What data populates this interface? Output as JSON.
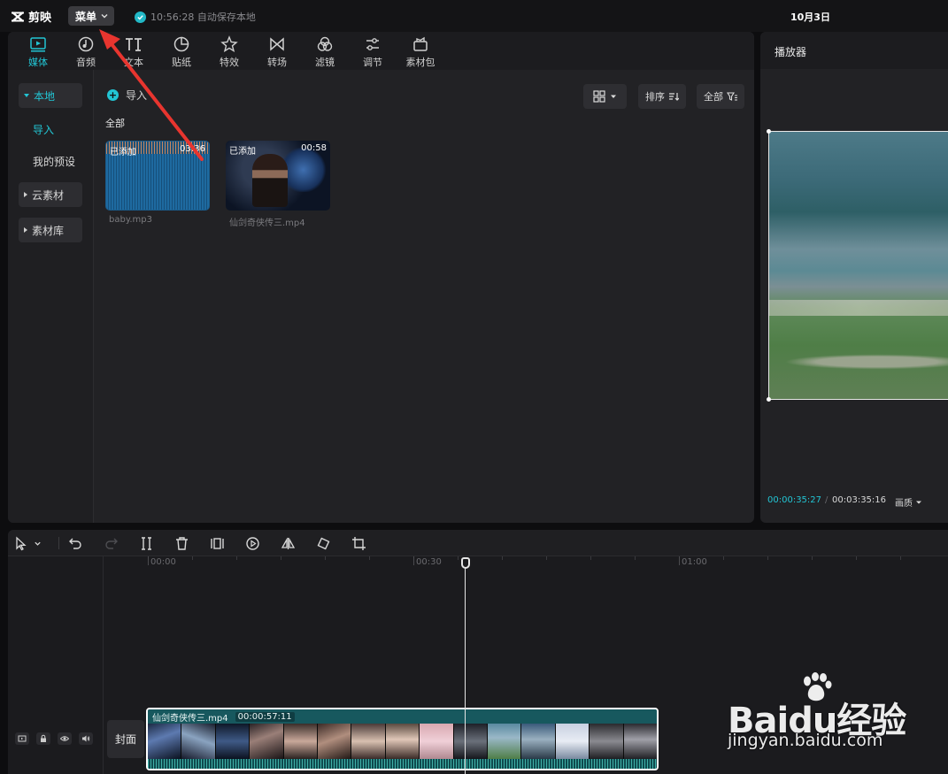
{
  "app": {
    "name": "剪映",
    "menu_label": "菜单"
  },
  "autosave": {
    "text": "10:56:28 自动保存本地"
  },
  "date": "10月3日",
  "tool_tabs": [
    {
      "label": "媒体",
      "icon": "media-icon",
      "active": true
    },
    {
      "label": "音频",
      "icon": "audio-icon"
    },
    {
      "label": "文本",
      "icon": "text-icon"
    },
    {
      "label": "贴纸",
      "icon": "sticker-icon"
    },
    {
      "label": "特效",
      "icon": "effects-icon"
    },
    {
      "label": "转场",
      "icon": "transition-icon"
    },
    {
      "label": "滤镜",
      "icon": "filter-icon"
    },
    {
      "label": "调节",
      "icon": "adjust-icon"
    },
    {
      "label": "素材包",
      "icon": "package-icon"
    }
  ],
  "sidebar": {
    "local": "本地",
    "import": "导入",
    "presets": "我的预设",
    "cloud": "云素材",
    "library": "素材库"
  },
  "content": {
    "import_label": "导入",
    "sort_label": "排序",
    "filter_label": "全部",
    "section_label": "全部",
    "items": [
      {
        "tag": "已添加",
        "duration": "03:36",
        "name": "baby.mp3"
      },
      {
        "tag": "已添加",
        "duration": "00:58",
        "name": "仙剑奇侠传三.mp4"
      }
    ]
  },
  "player": {
    "title": "播放器",
    "current_time": "00:00:35:27",
    "separator": "/",
    "total_time": "00:03:35:16",
    "quality_label": "画质"
  },
  "timeline": {
    "ruler": [
      "00:00",
      "00:30",
      "01:00"
    ],
    "cover_label": "封面",
    "clip": {
      "name": "仙剑奇侠传三.mp4",
      "duration": "00:00:57:11"
    }
  },
  "watermark": {
    "main": "Baidu经验",
    "sub": "jingyan.baidu.com"
  },
  "colors": {
    "accent": "#22c5d4",
    "arrow": "#e8352f",
    "clip": "#17585e"
  }
}
